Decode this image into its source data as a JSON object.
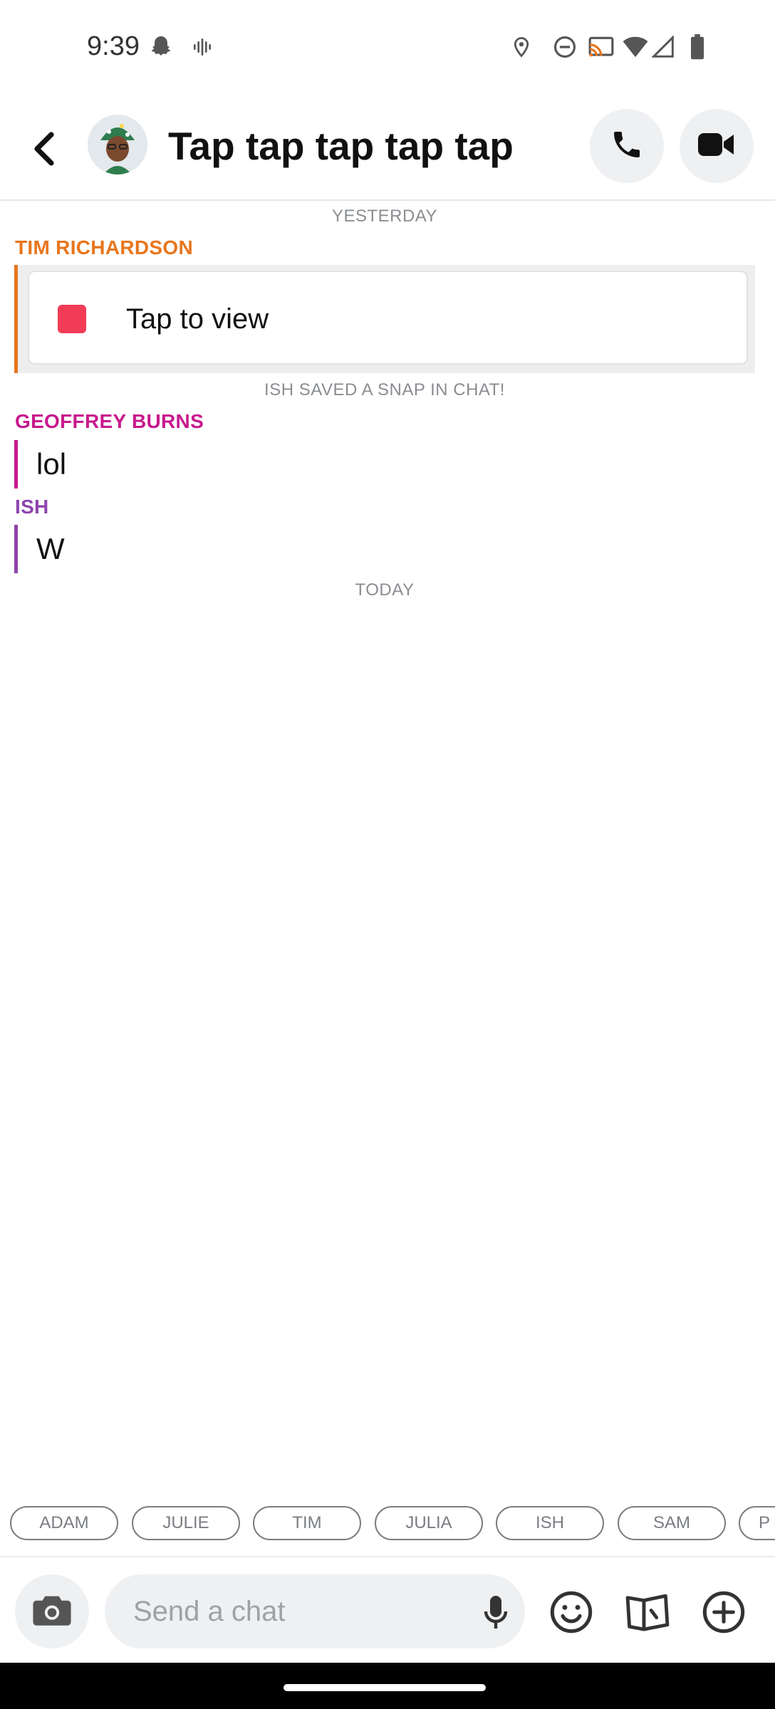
{
  "status_bar": {
    "time": "9:39",
    "icons": [
      "snapchat-ghost-icon",
      "voice-icon",
      "location-icon",
      "dnd-icon",
      "cast-icon",
      "wifi-icon",
      "signal-icon",
      "battery-icon"
    ]
  },
  "header": {
    "title": "Tap tap tap tap tap",
    "icons": [
      "back-icon",
      "avatar",
      "phone-icon",
      "video-icon"
    ]
  },
  "chat": {
    "separators": [
      "YESTERDAY",
      "TODAY"
    ],
    "system_notice": "ISH SAVED A SNAP IN CHAT!",
    "snap": {
      "sender": "TIM RICHARDSON",
      "label": "Tap to view"
    },
    "messages": [
      {
        "sender": "GEOFFREY BURNS",
        "text": "lol"
      },
      {
        "sender": "ISH",
        "text": "W"
      }
    ]
  },
  "quick_chips": [
    "ADAM",
    "JULIE",
    "TIM",
    "JULIA",
    "ISH",
    "SAM",
    "P"
  ],
  "input_bar": {
    "placeholder": "Send a chat",
    "icons": [
      "camera-icon",
      "mic-icon",
      "emoji-icon",
      "stickers-icon",
      "plus-icon"
    ]
  },
  "colors": {
    "tim": "#e8761d",
    "geoffrey": "#c8198c",
    "ish": "#8e44ad",
    "snap_square": "#f23c57"
  }
}
